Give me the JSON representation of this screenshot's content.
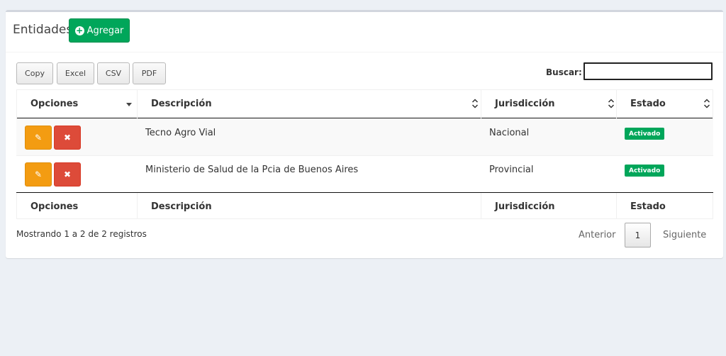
{
  "header": {
    "title": "Entidades",
    "add_label": "Agregar"
  },
  "export": {
    "copy": "Copy",
    "excel": "Excel",
    "csv": "CSV",
    "pdf": "PDF"
  },
  "search": {
    "label": "Buscar:",
    "value": ""
  },
  "table": {
    "columns": [
      "Opciones",
      "Descripción",
      "Jurisdicción",
      "Estado"
    ],
    "rows": [
      {
        "descripcion": "Tecno Agro Vial",
        "jurisdiccion": "Nacional",
        "estado": "Activado"
      },
      {
        "descripcion": "Ministerio de Salud de la Pcia de Buenos Aires",
        "jurisdiccion": "Provincial",
        "estado": "Activado"
      }
    ]
  },
  "footer": {
    "info": "Mostrando 1 a 2 de 2 registros",
    "prev": "Anterior",
    "page": "1",
    "next": "Siguiente"
  },
  "colors": {
    "add": "#00a65a",
    "edit": "#f39c12",
    "delete": "#dd4b39",
    "badge": "#00a65a"
  }
}
